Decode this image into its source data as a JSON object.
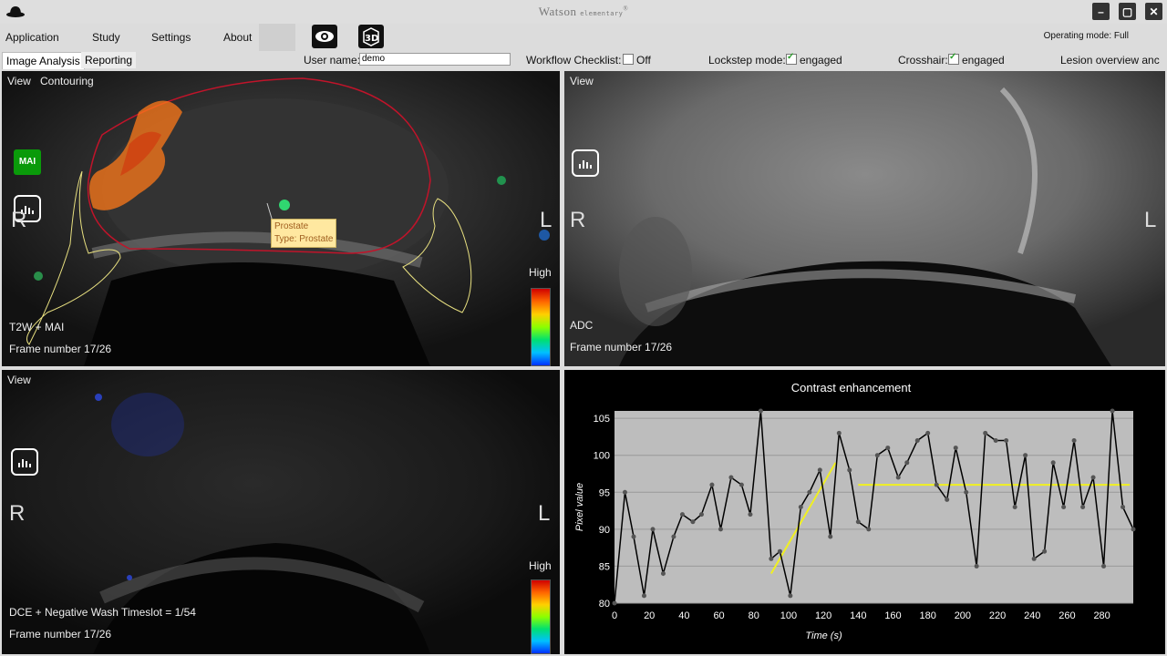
{
  "app": {
    "title": "Watson",
    "title_suffix": "elementary",
    "title_mark": "®",
    "window_buttons": [
      "minimize-icon",
      "maximize-icon",
      "close-icon"
    ]
  },
  "menu": {
    "items": [
      "Application",
      "Study",
      "Settings",
      "About"
    ],
    "tools": [
      "eye-icon",
      "3d-cube-icon"
    ],
    "operating_mode": "Operating mode: Full"
  },
  "tabs": [
    {
      "label": "Image Analysis",
      "active": true
    },
    {
      "label": "Reporting",
      "active": false
    }
  ],
  "toolbar": {
    "user_label": "User name:",
    "user_value": "demo",
    "workflow_label": "Workflow Checklist:",
    "workflow_value": "Off",
    "workflow_checked": false,
    "lockstep_label": "Lockstep mode:",
    "lockstep_value": "engaged",
    "lockstep_checked": true,
    "crosshair_label": "Crosshair:",
    "crosshair_value": "engaged",
    "crosshair_checked": true,
    "lesion_label": "Lesion overview anc"
  },
  "viewports": {
    "top_left": {
      "menu_view": "View",
      "menu_contouring": "Contouring",
      "mai_badge": "MAI",
      "orient_r": "R",
      "orient_l": "L",
      "series": "T2W + MAI",
      "frame": "Frame number   17/26",
      "colorbar_label": "High",
      "tooltip_line1": "Prostate",
      "tooltip_line2": "Type: Prostate"
    },
    "top_right": {
      "menu_view": "View",
      "orient_r": "R",
      "orient_l": "L",
      "series": "ADC",
      "frame": "Frame number   17/26"
    },
    "bottom_left": {
      "menu_view": "View",
      "orient_r": "R",
      "orient_l": "L",
      "series": "DCE + Negative Wash  Timeslot = 1/54",
      "frame": "Frame number   17/26",
      "colorbar_label": "High"
    }
  },
  "colors": {
    "prostate_contour": "#c0142a",
    "zone_contour": "#e8e080",
    "fit_line": "#f0f020",
    "chart_bg": "#bdbdbd"
  },
  "chart_data": {
    "type": "line",
    "title": "Contrast enhancement",
    "xlabel": "Time (s)",
    "ylabel": "Pixel value",
    "xlim": [
      0,
      298
    ],
    "ylim": [
      80,
      106
    ],
    "xticks": [
      0,
      20,
      40,
      60,
      80,
      100,
      120,
      140,
      160,
      180,
      200,
      220,
      240,
      260,
      280
    ],
    "yticks": [
      80,
      85,
      90,
      95,
      100,
      105
    ],
    "grid": true,
    "series": [
      {
        "x": [
          0,
          6,
          11,
          17,
          22,
          28,
          34,
          39,
          45,
          50,
          56,
          61,
          67,
          73,
          78,
          84,
          90,
          95,
          101,
          107,
          112,
          118,
          124,
          129,
          135,
          140,
          146,
          151,
          157,
          163,
          168,
          174,
          180,
          185,
          191,
          196,
          202,
          208,
          213,
          219,
          225,
          230,
          236,
          241,
          247,
          252,
          258,
          264,
          269,
          275,
          281,
          286,
          292,
          298
        ],
        "y": [
          80,
          95,
          89,
          81,
          90,
          84,
          89,
          92,
          91,
          92,
          96,
          90,
          97,
          96,
          92,
          106,
          86,
          87,
          81,
          93,
          95,
          98,
          89,
          103,
          98,
          91,
          90,
          100,
          101,
          97,
          99,
          102,
          103,
          96,
          94,
          101,
          95,
          85,
          103,
          102,
          102,
          93,
          100,
          86,
          87,
          99,
          93,
          102,
          93,
          97,
          85,
          106,
          93,
          90
        ]
      }
    ],
    "fit_lines": [
      {
        "x": [
          90,
          127
        ],
        "y": [
          84,
          99
        ]
      },
      {
        "x": [
          140,
          296
        ],
        "y": [
          96,
          96
        ]
      }
    ]
  }
}
